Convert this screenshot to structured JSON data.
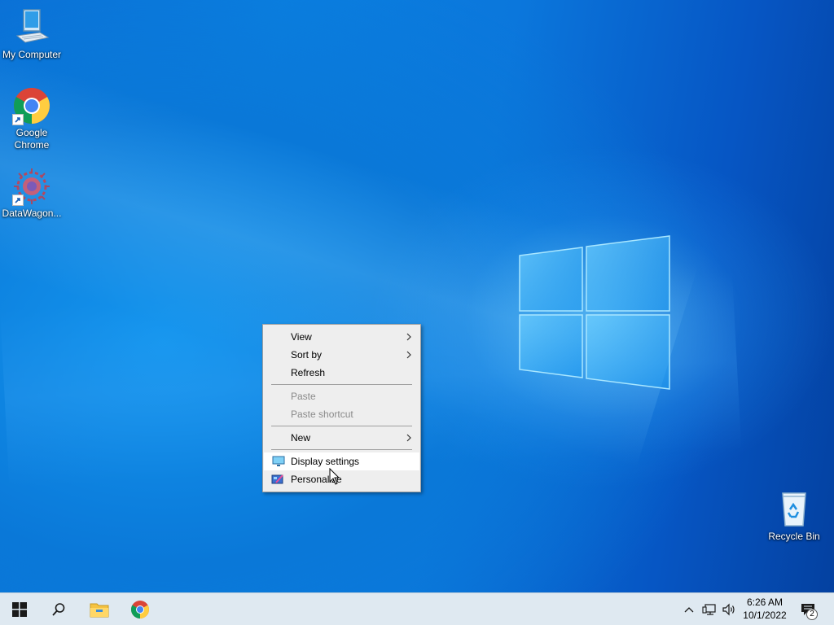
{
  "desktop": {
    "icons": [
      {
        "label": "My Computer",
        "icon": "computer-icon"
      },
      {
        "label": "Google Chrome",
        "icon": "chrome-icon"
      },
      {
        "label": "DataWagon...",
        "icon": "datawagon-icon"
      },
      {
        "label": "Recycle Bin",
        "icon": "recycle-bin-icon"
      }
    ]
  },
  "context_menu": {
    "items": [
      {
        "label": "View",
        "submenu": true,
        "enabled": true
      },
      {
        "label": "Sort by",
        "submenu": true,
        "enabled": true
      },
      {
        "label": "Refresh",
        "enabled": true
      },
      {
        "label": "Paste",
        "enabled": false
      },
      {
        "label": "Paste shortcut",
        "enabled": false
      },
      {
        "label": "New",
        "submenu": true,
        "enabled": true
      },
      {
        "label": "Display settings",
        "enabled": true,
        "highlighted": true,
        "icon": "display-icon"
      },
      {
        "label": "Personalize",
        "enabled": true,
        "icon": "personalize-icon"
      }
    ]
  },
  "taskbar": {
    "start": "windows-start-icon",
    "search": "search-icon",
    "pinned": [
      "file-explorer-icon",
      "chrome-icon"
    ],
    "tray_icons": [
      "chevron-up-icon",
      "network-icon",
      "volume-icon"
    ],
    "time": "6:26 AM",
    "date": "10/1/2022",
    "notification_count": "2"
  },
  "colors": {
    "desktop_blue": "#0a78d8",
    "taskbar_bg": "#dfe9f1",
    "menu_bg": "#eeeeee",
    "menu_highlight": "#ffffff"
  }
}
